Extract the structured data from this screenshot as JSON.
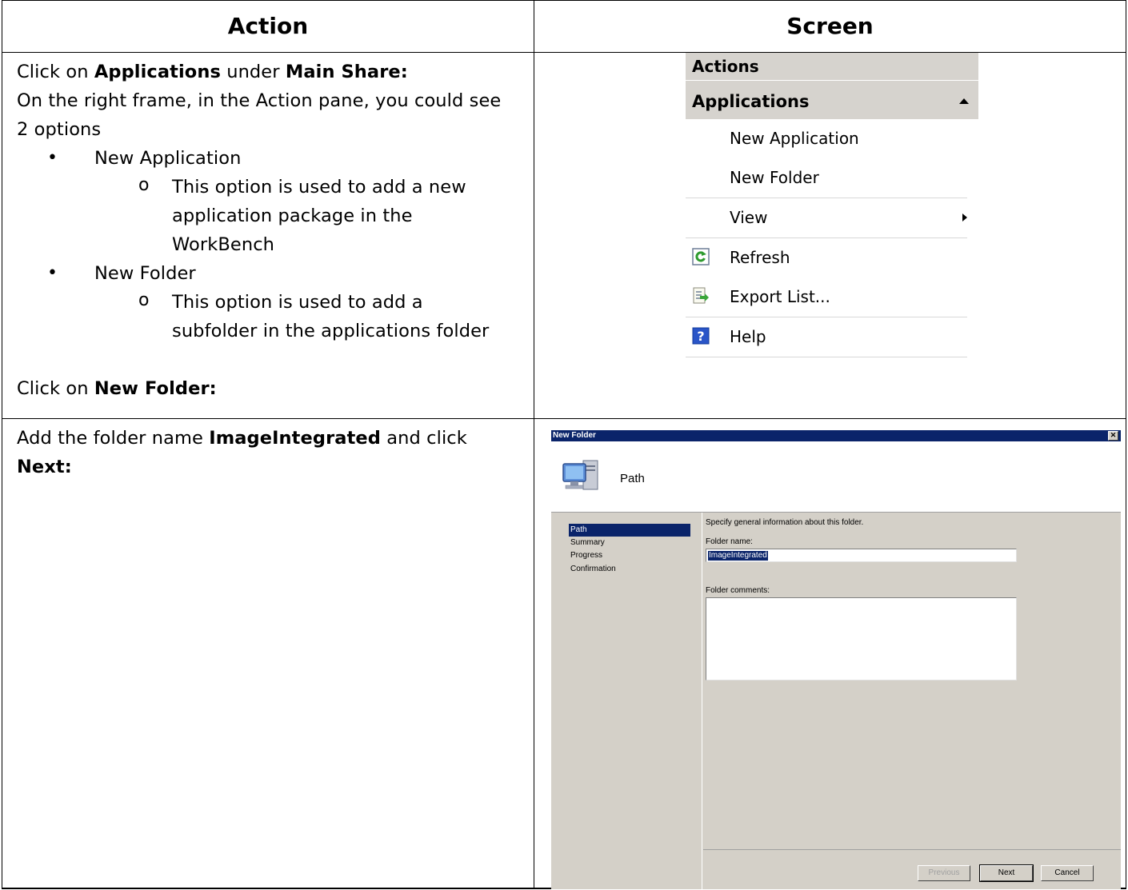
{
  "table": {
    "col_action": "Action",
    "col_screen": "Screen"
  },
  "row1": {
    "line1_pre": "Click on ",
    "line1_b1": "Applications",
    "line1_mid": " under ",
    "line1_b2": "Main Share:",
    "line2": "On the right frame, in the Action pane, you could see",
    "line3": "2 options",
    "bullet1": "New Application",
    "bullet1_sub_1": "This option is used to add a new",
    "bullet1_sub_2": "application package in the",
    "bullet1_sub_3": "WorkBench",
    "bullet2": "New Folder",
    "bullet2_sub_1": "This option is used to add a",
    "bullet2_sub_2": "subfolder in the applications folder",
    "click_pre": "Click on ",
    "click_b": "New  Folder:",
    "bullet_char": "•",
    "sub_bullet_char": "o"
  },
  "action_pane": {
    "header": "Actions",
    "section": "Applications",
    "items": [
      {
        "label": "New Application",
        "icon": ""
      },
      {
        "label": "New Folder",
        "icon": ""
      },
      {
        "label": "View",
        "icon": "submenu-arrow"
      },
      {
        "label": "Refresh",
        "icon": "refresh-icon"
      },
      {
        "label": "Export List...",
        "icon": "export-icon"
      },
      {
        "label": "Help",
        "icon": "help-icon"
      }
    ]
  },
  "row2": {
    "line1_pre": "Add the folder name ",
    "line1_b": "ImageIntegrated",
    "line1_post": " and click",
    "line2_b": "Next:"
  },
  "dialog": {
    "title": "New Folder",
    "close": "✕",
    "page_title": "Path",
    "nav": [
      "Path",
      "Summary",
      "Progress",
      "Confirmation"
    ],
    "intro": "Specify general information about this folder.",
    "folder_name_label": "Folder name:",
    "folder_name_value": "ImageIntegrated",
    "folder_comments_label": "Folder comments:",
    "folder_comments_value": "",
    "btn_previous": "Previous",
    "btn_next": "Next",
    "btn_cancel": "Cancel"
  }
}
